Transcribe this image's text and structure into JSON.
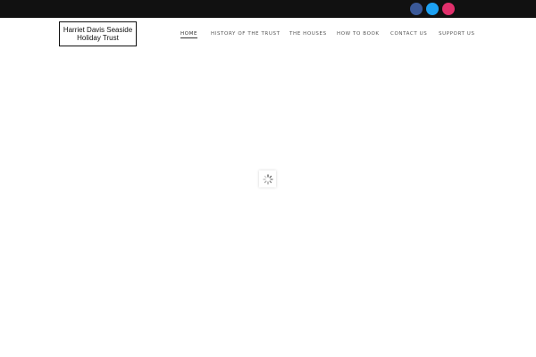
{
  "social": {
    "facebook_icon": "facebook-icon",
    "twitter_icon": "twitter-icon",
    "instagram_icon": "instagram-icon",
    "colors": {
      "facebook": "#3b5998",
      "twitter": "#1da1f2",
      "instagram": "#e1306c"
    }
  },
  "logo": {
    "line1": "Harriet Davis Seaside",
    "line2": "Holiday Trust"
  },
  "nav": {
    "items": [
      {
        "label": "HOME",
        "active": true
      },
      {
        "label": "HISTORY OF THE TRUST",
        "active": false
      },
      {
        "label": "THE HOUSES",
        "active": false
      },
      {
        "label": "HOW TO BOOK",
        "active": false
      },
      {
        "label": "CONTACT US",
        "active": false
      },
      {
        "label": "SUPPORT US",
        "active": false
      }
    ]
  },
  "loader": {
    "icon": "loading-spinner-icon"
  },
  "colors": {
    "topbar": "#111111",
    "background": "#ffffff"
  }
}
